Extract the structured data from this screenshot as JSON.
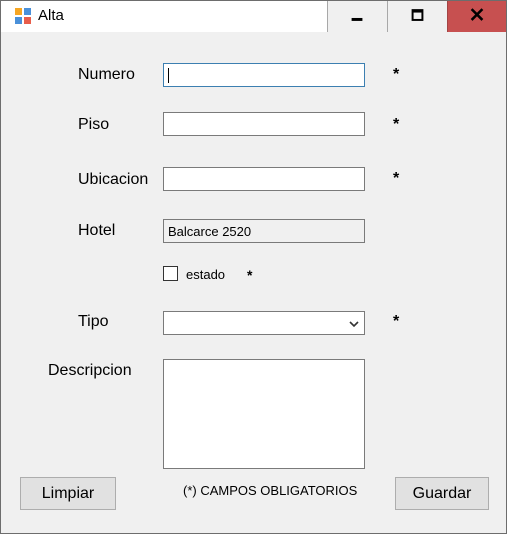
{
  "window": {
    "title": "Alta",
    "buttons": {
      "minimize": "minimize",
      "maximize": "maximize",
      "close": "X"
    }
  },
  "form": {
    "numero": {
      "label": "Numero",
      "value": "",
      "required_mark": "*"
    },
    "piso": {
      "label": "Piso",
      "value": "",
      "required_mark": "*"
    },
    "ubicacion": {
      "label": "Ubicacion",
      "value": "",
      "required_mark": "*"
    },
    "hotel": {
      "label": "Hotel",
      "value": "Balcarce 2520"
    },
    "estado": {
      "label": "estado",
      "checked": false,
      "required_mark": "*"
    },
    "tipo": {
      "label": "Tipo",
      "selected": "",
      "required_mark": "*"
    },
    "descripcion": {
      "label": "Descripcion",
      "value": ""
    }
  },
  "footer": {
    "clear_label": "Limpiar",
    "required_note": "(*) CAMPOS OBLIGATORIOS",
    "save_label": "Guardar"
  },
  "colors": {
    "close_button": "#c75050",
    "focus_border": "#3c7fb1",
    "window_bg": "#f0f0f0"
  }
}
